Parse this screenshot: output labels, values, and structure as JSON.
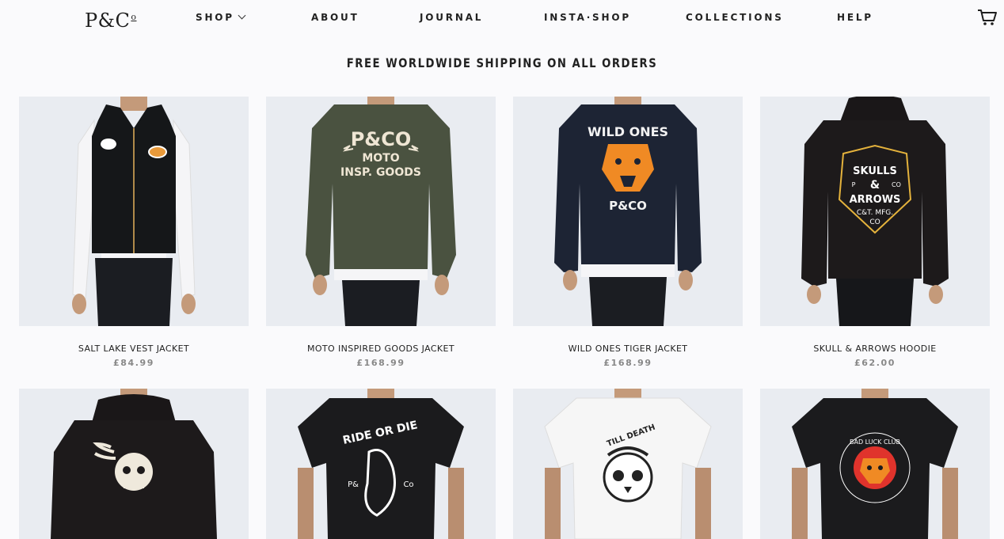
{
  "header": {
    "logo": "P&C",
    "logo_sup": "o",
    "nav": [
      "SHOP",
      "ABOUT",
      "JOURNAL",
      "INSTA·SHOP",
      "COLLECTIONS",
      "HELP"
    ]
  },
  "promo": "FREE WORLDWIDE SHIPPING ON ALL ORDERS",
  "products": [
    {
      "name": "SALT LAKE VEST JACKET",
      "price": "£84.99"
    },
    {
      "name": "MOTO INSPIRED GOODS JACKET",
      "price": "£168.99"
    },
    {
      "name": "WILD ONES TIGER JACKET",
      "price": "£168.99"
    },
    {
      "name": "SKULL & ARROWS HOODIE",
      "price": "£62.00"
    }
  ],
  "print_text": {
    "moto": [
      "P&CO",
      "MOTO",
      "INSP. GOODS"
    ],
    "wild": [
      "WILD ONES",
      "P&CO"
    ],
    "skulls": [
      "SKULLS",
      "&",
      "ARROWS",
      "C&T. MFG.",
      "CO",
      "P",
      "CO"
    ],
    "ride": [
      "RIDE OR DIE",
      "P&",
      "Co"
    ],
    "till": "TILL DEATH",
    "badluck": "BAD LUCK CLUB"
  },
  "colors": {
    "background": "#fafafc",
    "photo_bg": "#e9ecf1",
    "text": "#1e1e1e",
    "price": "#888888",
    "tiger_orange": "#f08a24",
    "badluck_red": "#e0332c"
  }
}
